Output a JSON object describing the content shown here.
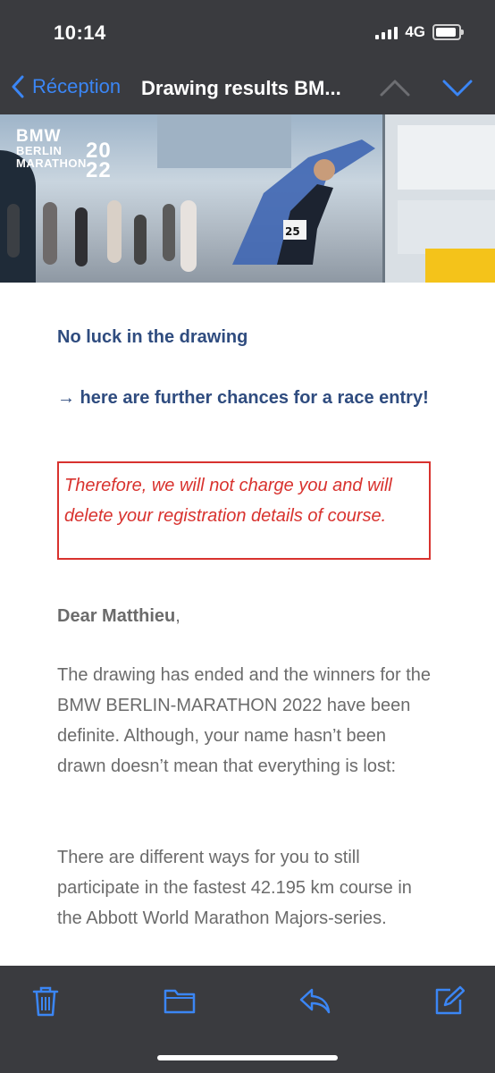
{
  "status_bar": {
    "time": "10:14",
    "network": "4G"
  },
  "nav": {
    "back_label": "Réception",
    "title": "Drawing results BM..."
  },
  "banner": {
    "logo_line1": "BMW",
    "logo_line2": "BERLIN",
    "logo_line3": "MARATHON",
    "logo_year": "20\n22"
  },
  "email": {
    "heading1": "No luck in the drawing",
    "heading2": "→ here are further chances for a race entry!",
    "highlight": "Therefore, we will not charge you and will delete your registration details of course.",
    "greeting_bold": "Dear Matthieu",
    "greeting_suffix": ",",
    "paragraph1": "The drawing has ended and the winners for the BMW BERLIN-MARATHON 2022 have been definite. Although, your name hasn’t been drawn doesn’t mean that everything is lost:",
    "paragraph2": "There are different ways for you to still participate in the fastest 42.195 km course in the Abbott World Marathon Majors-series."
  },
  "toolbar": {
    "icons": [
      "trash-icon",
      "folder-icon",
      "reply-icon",
      "compose-icon"
    ]
  },
  "colors": {
    "accent": "#3b86f5",
    "heading": "#2f4c7f",
    "alert": "#d8322e",
    "body_text": "#6b6b6b",
    "chrome": "#3a3b3f"
  }
}
